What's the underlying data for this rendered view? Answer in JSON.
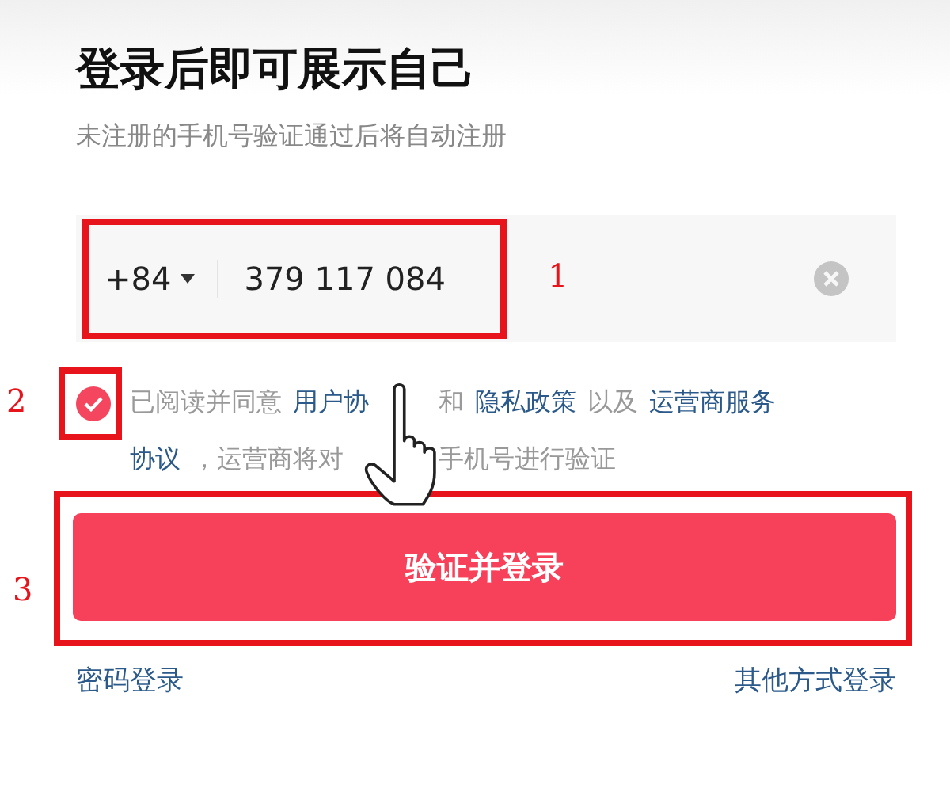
{
  "title": "登录后即可展示自己",
  "subtitle": "未注册的手机号验证通过后将自动注册",
  "phone": {
    "country_code": "+84",
    "value": "379 117 084"
  },
  "agreement": {
    "checked": true,
    "lines": [
      {
        "before_hand": [
          {
            "kind": "text",
            "text": "已阅读并同意"
          },
          {
            "kind": "link",
            "text": "用户协"
          }
        ],
        "after_hand": [
          {
            "kind": "text",
            "text": "和"
          },
          {
            "kind": "link",
            "text": "隐私政策"
          },
          {
            "kind": "text",
            "text": "以及"
          },
          {
            "kind": "link",
            "text": "运营商服务"
          }
        ]
      },
      {
        "before_hand": [
          {
            "kind": "link",
            "text": "协议"
          },
          {
            "kind": "text",
            "text": "，运营商将对"
          }
        ],
        "after_hand": [
          {
            "kind": "text",
            "text": "手机号进行验证"
          }
        ]
      }
    ]
  },
  "login_button": "验证并登录",
  "footer_links": [
    "密码登录",
    "其他方式登录"
  ],
  "annotations": [
    "1",
    "2",
    "3"
  ]
}
